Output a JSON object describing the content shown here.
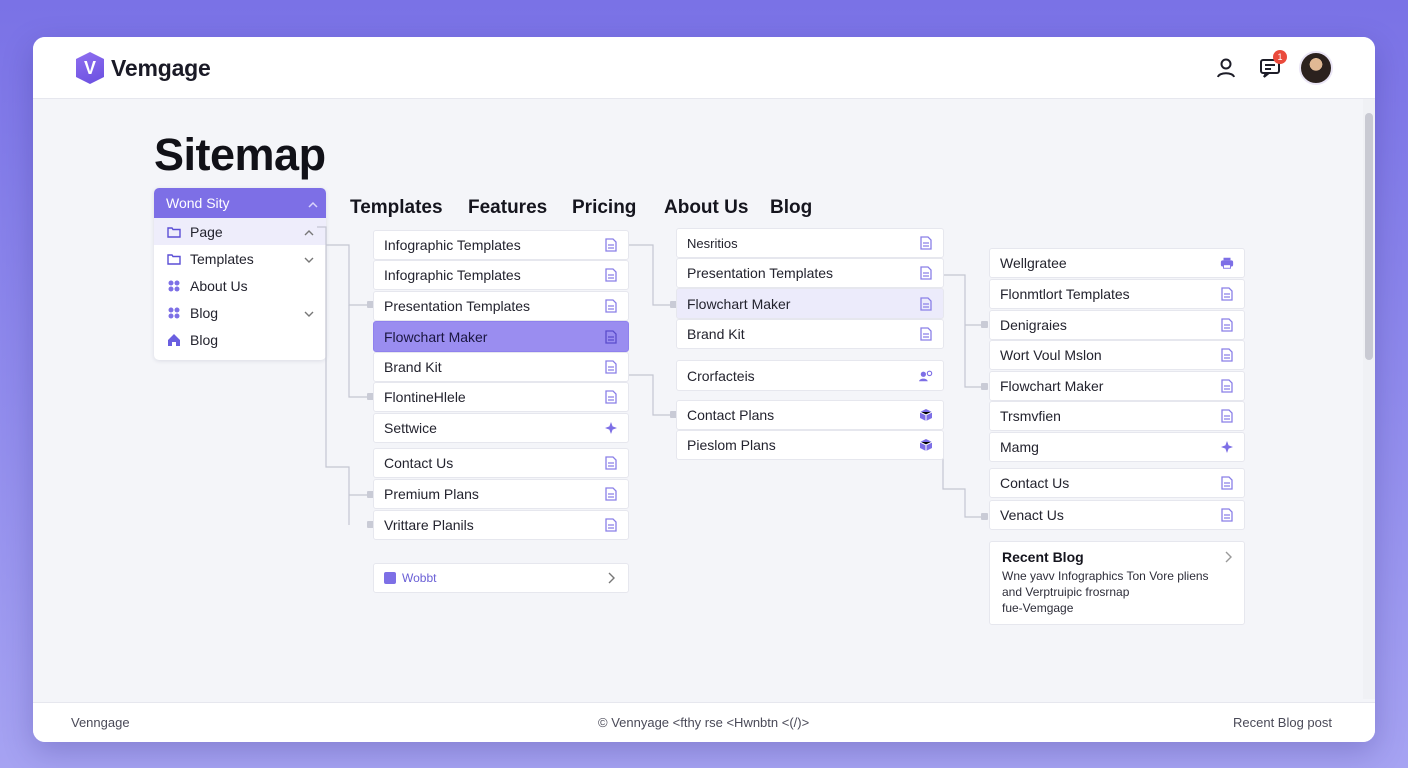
{
  "app": {
    "name": "Vemgage",
    "logo_letter": "V"
  },
  "header": {
    "notification_count": "1"
  },
  "page": {
    "title": "Sitemap"
  },
  "sidebar": {
    "header": "Wond Sity",
    "items": [
      {
        "label": "Page",
        "icon": "folder-icon"
      },
      {
        "label": "Templates",
        "icon": "folder-icon"
      },
      {
        "label": "About Us",
        "icon": "grid-icon"
      },
      {
        "label": "Blog",
        "icon": "grid-icon"
      },
      {
        "label": "Blog",
        "icon": "home-icon"
      }
    ]
  },
  "tabs": [
    "Templates",
    "Features",
    "Pricing",
    "About Us",
    "Blog"
  ],
  "column1": {
    "group1": [
      "Infographic Templates",
      "Infographic Templates",
      "Presentation Templates",
      "Flowchart Maker",
      "Brand Kit",
      "FlontineHlele",
      "Settwice"
    ],
    "group2": [
      "Contact Us",
      "Premium Plans",
      "Vrittare Planils"
    ],
    "footer_item": "Wobbt"
  },
  "column2": {
    "group1": [
      "Nesritios",
      "Presentation Templates",
      "Flowchart Maker",
      "Brand Kit"
    ],
    "group2": [
      "Crorfacteis"
    ],
    "group3": [
      "Contact Plans",
      "Pieslom Plans"
    ]
  },
  "column3": {
    "group1": [
      "Wellgratee",
      "Flonmtlort Templates",
      "Denigraies",
      "Wort Voul Mslon",
      "Flowchart Maker",
      "Trsmvfien",
      "Mamg"
    ],
    "group2": [
      "Contact Us",
      "Venact Us"
    ]
  },
  "recent_blog": {
    "title": "Recent Blog",
    "lines": [
      "Wne yavv Infographics Ton Vore pliens",
      "and Verptruipic frosrnap",
      "fue-Vemgage"
    ]
  },
  "footer": {
    "left": "Venngage",
    "middle": "© Vennyage <fthy rse <Hwnbtn <(/)>",
    "right": "Recent Blog post"
  },
  "colors": {
    "accent": "#7d6fe6",
    "highlight": "#9a8df0",
    "icon": "#7d6fe6"
  }
}
